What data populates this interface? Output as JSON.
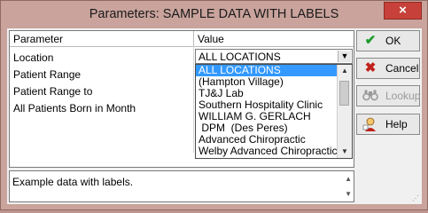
{
  "window": {
    "title": "Parameters: SAMPLE DATA WITH LABELS",
    "close_glyph": "×"
  },
  "grid": {
    "headers": {
      "parameter": "Parameter",
      "value": "Value"
    },
    "rows": [
      {
        "parameter": "Location"
      },
      {
        "parameter": "Patient Range"
      },
      {
        "parameter": "Patient Range to"
      },
      {
        "parameter": "All Patients Born in Month"
      }
    ]
  },
  "location_combo": {
    "value": "ALL LOCATIONS",
    "options": [
      "ALL LOCATIONS",
      "(Hampton Village)",
      "TJ&J Lab",
      "Southern Hospitality Clinic",
      "WILLIAM G. GERLACH",
      " DPM  (Des Peres)",
      "Advanced Chiropractic",
      "Welby Advanced Chiropractic"
    ],
    "selected_index": 0
  },
  "buttons": {
    "ok": {
      "label": "OK",
      "icon": "check-icon",
      "color": "#1e9a2e"
    },
    "cancel": {
      "label": "Cancel",
      "icon": "x-icon",
      "color": "#c0201c"
    },
    "lookup": {
      "label": "Lookup",
      "icon": "binoculars-icon",
      "enabled": false
    },
    "help": {
      "label": "Help",
      "icon": "help-person-icon"
    }
  },
  "description": {
    "text": "Example data with labels."
  },
  "colors": {
    "frame": "#c9a39c",
    "selection": "#3399ff",
    "close": "#c7413a"
  }
}
